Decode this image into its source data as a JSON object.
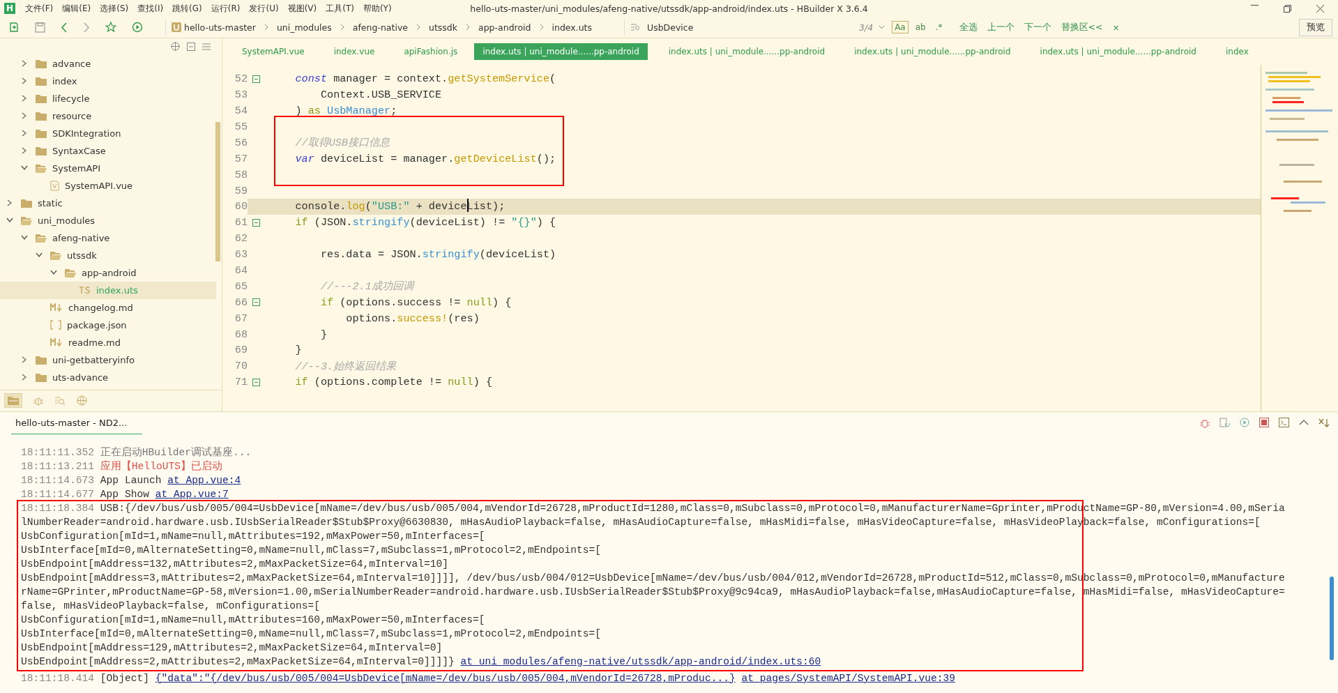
{
  "window": {
    "logo": "H",
    "title": "hello-uts-master/uni_modules/afeng-native/utssdk/app-android/index.uts - HBuilder X 3.6.4"
  },
  "menu": [
    "文件(F)",
    "编辑(E)",
    "选择(S)",
    "查找(I)",
    "跳转(G)",
    "运行(R)",
    "发行(U)",
    "视图(V)",
    "工具(T)",
    "帮助(Y)"
  ],
  "breadcrumb": [
    "hello-uts-master",
    "uni_modules",
    "afeng-native",
    "utssdk",
    "app-android",
    "index.uts"
  ],
  "find": {
    "value": "UsbDevice",
    "count": "3/4",
    "options": [
      {
        "label": "Aa",
        "selected": true
      },
      {
        "label": "ab",
        "selected": false
      },
      {
        "label": ".*",
        "selected": false
      }
    ],
    "actions": [
      "全选",
      "上一个",
      "下一个",
      "替换区<<",
      "×"
    ]
  },
  "preview_button": "预览",
  "tree": {
    "partial_children": [
      {
        "label": "advance",
        "kind": "folder",
        "expanded": false
      },
      {
        "label": "index",
        "kind": "folder",
        "expanded": false
      },
      {
        "label": "lifecycle",
        "kind": "folder",
        "expanded": false
      },
      {
        "label": "resource",
        "kind": "folder",
        "expanded": false
      },
      {
        "label": "SDKIntegration",
        "kind": "folder",
        "expanded": false
      },
      {
        "label": "SyntaxCase",
        "kind": "folder",
        "expanded": false
      },
      {
        "label": "SystemAPI",
        "kind": "folder",
        "expanded": true,
        "children": [
          {
            "label": "SystemAPI.vue",
            "kind": "vue",
            "selected": false
          }
        ]
      }
    ],
    "items": [
      {
        "label": "static",
        "kind": "folder",
        "expanded": false
      },
      {
        "label": "uni_modules",
        "kind": "folder",
        "expanded": true,
        "children": [
          {
            "label": "afeng-native",
            "kind": "folder",
            "expanded": true,
            "children": [
              {
                "label": "utssdk",
                "kind": "folder",
                "expanded": true,
                "children": [
                  {
                    "label": "app-android",
                    "kind": "folder",
                    "expanded": true,
                    "children": [
                      {
                        "label": "index.uts",
                        "kind": "ts",
                        "selected": true
                      }
                    ]
                  }
                ]
              },
              {
                "label": "changelog.md",
                "kind": "md",
                "selected": false
              },
              {
                "label": "package.json",
                "kind": "json",
                "selected": false
              },
              {
                "label": "readme.md",
                "kind": "md",
                "selected": false
              }
            ]
          },
          {
            "label": "uni-getbatteryinfo",
            "kind": "folder",
            "expanded": false
          },
          {
            "label": "uts-advance",
            "kind": "folder",
            "expanded": false
          }
        ]
      }
    ]
  },
  "tabs": [
    {
      "label": "SystemAPI.vue",
      "selected": false
    },
    {
      "label": "index.vue",
      "selected": false
    },
    {
      "label": "apiFashion.js",
      "selected": false
    },
    {
      "label": "index.uts | uni_module......pp-android",
      "selected": true
    },
    {
      "label": "index.uts | uni_module......pp-android",
      "selected": false
    },
    {
      "label": "index.uts | uni_module......pp-android",
      "selected": false
    },
    {
      "label": "index.uts | uni_module......pp-android",
      "selected": false
    },
    {
      "label": "index",
      "selected": false
    }
  ],
  "code": [
    {
      "number": "52",
      "foldable": true,
      "current": false,
      "marked": false,
      "tokens": [
        {
          "kind": "kw",
          "text": "    const"
        },
        {
          "kind": "plain",
          "text": " manager = context."
        },
        {
          "kind": "fn",
          "text": "getSystemService"
        },
        {
          "kind": "plain",
          "text": "("
        }
      ]
    },
    {
      "number": "53",
      "foldable": false,
      "current": false,
      "marked": false,
      "tokens": [
        {
          "kind": "plain",
          "text": "        Context.USB_SERVICE"
        }
      ]
    },
    {
      "number": "54",
      "foldable": false,
      "current": false,
      "marked": false,
      "tokens": [
        {
          "kind": "plain",
          "text": "    ) "
        },
        {
          "kind": "ctl",
          "text": "as "
        },
        {
          "kind": "type",
          "text": "UsbManager"
        },
        {
          "kind": "plain",
          "text": ";"
        }
      ]
    },
    {
      "number": "55",
      "foldable": false,
      "current": false,
      "marked": true
    },
    {
      "number": "56",
      "foldable": false,
      "current": false,
      "marked": true,
      "tokens": [
        {
          "kind": "comment",
          "text": "    //取得USB接口信息"
        }
      ]
    },
    {
      "number": "57",
      "foldable": false,
      "current": false,
      "marked": true,
      "tokens": [
        {
          "kind": "kw",
          "text": "    var"
        },
        {
          "kind": "plain",
          "text": " deviceList = manager."
        },
        {
          "kind": "fn",
          "text": "getDeviceList"
        },
        {
          "kind": "plain",
          "text": "();"
        }
      ]
    },
    {
      "number": "58",
      "foldable": false,
      "current": false,
      "marked": true
    },
    {
      "number": "59",
      "foldable": false,
      "current": false,
      "marked": false
    },
    {
      "number": "60",
      "foldable": false,
      "current": true,
      "marked": false,
      "tokens": [
        {
          "kind": "plain",
          "text": "    console."
        },
        {
          "kind": "fn",
          "text": "log"
        },
        {
          "kind": "plain",
          "text": "("
        },
        {
          "kind": "str",
          "text": "\"USB:\""
        },
        {
          "kind": "plain",
          "text": " + deviceList);"
        }
      ]
    },
    {
      "number": "61",
      "foldable": true,
      "current": false,
      "marked": false,
      "tokens": [
        {
          "kind": "ctl",
          "text": "    if"
        },
        {
          "kind": "plain",
          "text": " (JSON."
        },
        {
          "kind": "type",
          "text": "stringify"
        },
        {
          "kind": "plain",
          "text": "(deviceList) != "
        },
        {
          "kind": "str",
          "text": "\"{}\""
        },
        {
          "kind": "plain",
          "text": ") {"
        }
      ]
    },
    {
      "number": "62",
      "foldable": false,
      "current": false,
      "marked": false
    },
    {
      "number": "63",
      "foldable": false,
      "current": false,
      "marked": false,
      "tokens": [
        {
          "kind": "plain",
          "text": "        res.data = JSON."
        },
        {
          "kind": "type",
          "text": "stringify"
        },
        {
          "kind": "plain",
          "text": "(deviceList)"
        }
      ]
    },
    {
      "number": "64",
      "foldable": false,
      "current": false,
      "marked": false
    },
    {
      "number": "65",
      "foldable": false,
      "current": false,
      "marked": false,
      "tokens": [
        {
          "kind": "comment",
          "text": "        //---2.1成功回调"
        }
      ]
    },
    {
      "number": "66",
      "foldable": true,
      "current": false,
      "marked": false,
      "tokens": [
        {
          "kind": "ctl",
          "text": "        if"
        },
        {
          "kind": "plain",
          "text": " (options.success != "
        },
        {
          "kind": "ctl",
          "text": "null"
        },
        {
          "kind": "plain",
          "text": ") {"
        }
      ]
    },
    {
      "number": "67",
      "foldable": false,
      "current": false,
      "marked": false,
      "tokens": [
        {
          "kind": "plain",
          "text": "            options."
        },
        {
          "kind": "fn",
          "text": "success!"
        },
        {
          "kind": "plain",
          "text": "(res)"
        }
      ]
    },
    {
      "number": "68",
      "foldable": false,
      "current": false,
      "marked": false,
      "tokens": [
        {
          "kind": "plain",
          "text": "        }"
        }
      ]
    },
    {
      "number": "69",
      "foldable": false,
      "current": false,
      "marked": false,
      "tokens": [
        {
          "kind": "plain",
          "text": "    }"
        }
      ]
    },
    {
      "number": "70",
      "foldable": false,
      "current": false,
      "marked": false,
      "tokens": [
        {
          "kind": "comment",
          "text": "    //--3.始终返回结果"
        }
      ]
    },
    {
      "number": "71",
      "foldable": true,
      "current": false,
      "marked": false,
      "tokens": [
        {
          "kind": "ctl",
          "text": "    if"
        },
        {
          "kind": "plain",
          "text": " (options.complete != "
        },
        {
          "kind": "ctl",
          "text": "null"
        },
        {
          "kind": "plain",
          "text": ") {"
        }
      ]
    }
  ],
  "console": {
    "tab": "hello-uts-master - ND2...",
    "entries": [
      {
        "time": "18:11:11.352",
        "kind": "info",
        "marked": false,
        "lines": [
          "正在启动HBuilder调试基座..."
        ]
      },
      {
        "time": "18:11:13.211",
        "kind": "notice",
        "marked": false,
        "lines": [
          "应用【HelloUTS】已启动"
        ]
      },
      {
        "time": "18:11:14.673",
        "kind": "log",
        "marked": false,
        "lines": [
          "App Launch"
        ],
        "links": [
          "at App.vue:4"
        ]
      },
      {
        "time": "18:11:14.677",
        "kind": "log",
        "marked": false,
        "lines": [
          "App Show"
        ],
        "links": [
          "at App.vue:7"
        ]
      },
      {
        "time": "18:11:18.384",
        "kind": "log",
        "marked": true,
        "lines": [
          "USB:{/dev/bus/usb/005/004=UsbDevice[mName=/dev/bus/usb/005/004,mVendorId=26728,mProductId=1280,mClass=0,mSubclass=0,mProtocol=0,mManufacturerName=Gprinter,mProductName=GP-80,mVersion=4.00,mSeria",
          "lNumberReader=android.hardware.usb.IUsbSerialReader$Stub$Proxy@6630830, mHasAudioPlayback=false, mHasAudioCapture=false, mHasMidi=false, mHasVideoCapture=false, mHasVideoPlayback=false, mConfigurations=[",
          "UsbConfiguration[mId=1,mName=null,mAttributes=192,mMaxPower=50,mInterfaces=[",
          "UsbInterface[mId=0,mAlternateSetting=0,mName=null,mClass=7,mSubclass=1,mProtocol=2,mEndpoints=[",
          "UsbEndpoint[mAddress=132,mAttributes=2,mMaxPacketSize=64,mInterval=10]",
          "UsbEndpoint[mAddress=3,mAttributes=2,mMaxPacketSize=64,mInterval=10]]]], /dev/bus/usb/004/012=UsbDevice[mName=/dev/bus/usb/004/012,mVendorId=26728,mProductId=512,mClass=0,mSubclass=0,mProtocol=0,mManufacture",
          "rName=GPrinter,mProductName=GP-58,mVersion=1.00,mSerialNumberReader=android.hardware.usb.IUsbSerialReader$Stub$Proxy@9c94ca9, mHasAudioPlayback=false,mHasAudioCapture=false, mHasMidi=false, mHasVideoCapture=",
          "false, mHasVideoPlayback=false, mConfigurations=[",
          "UsbConfiguration[mId=1,mName=null,mAttributes=160,mMaxPower=50,mInterfaces=[",
          "UsbInterface[mId=0,mAlternateSetting=0,mName=null,mClass=7,mSubclass=1,mProtocol=2,mEndpoints=[",
          "UsbEndpoint[mAddress=129,mAttributes=2,mMaxPacketSize=64,mInterval=0]",
          "UsbEndpoint[mAddress=2,mAttributes=2,mMaxPacketSize=64,mInterval=0]]]]}"
        ],
        "links": [
          "at uni_modules/afeng-native/utssdk/app-android/index.uts:60"
        ]
      },
      {
        "time": "18:11:18.414",
        "kind": "log",
        "marked": false,
        "lines": [
          "[Object]"
        ],
        "links": [
          "{\"data\":\"{/dev/bus/usb/005/004=UsbDevice[mName=/dev/bus/usb/005/004,mVendorId=26728,mProduc...}",
          "at pages/SystemAPI/SystemAPI.vue:39"
        ]
      }
    ]
  }
}
